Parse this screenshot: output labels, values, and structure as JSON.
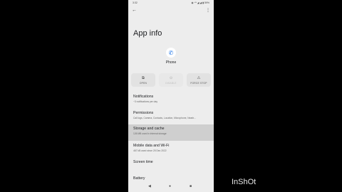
{
  "status_bar": {
    "time": "3:32",
    "icons": "◉ ⁴ᴳ ◢ ◢ ▮ 59%"
  },
  "header": {
    "back_glyph": "←",
    "more_glyph": "⋮",
    "title": "App info"
  },
  "app": {
    "icon_glyph": "✆",
    "name": "Phone"
  },
  "actions": {
    "open": {
      "icon": "⧉",
      "label": "OPEN"
    },
    "uninstall": {
      "icon": "⊖",
      "label": "DISABLE"
    },
    "force_stop": {
      "icon": "⚠",
      "label": "FORCE STOP"
    }
  },
  "settings": [
    {
      "title": "Notifications",
      "subtitle": "~3 notifications per day"
    },
    {
      "title": "Permissions",
      "subtitle": "Call logs, Camera, Contacts, Location, Microphone, Nearb..."
    },
    {
      "title": "Storage and cache",
      "subtitle": "126 MB used in internal storage"
    },
    {
      "title": "Mobile data and Wi-Fi",
      "subtitle": "467 kB used since 25 Dec 2022"
    },
    {
      "title": "Screen time",
      "subtitle": ""
    },
    {
      "title": "Battery",
      "subtitle": ""
    }
  ],
  "nav_bar": {
    "back": "◀",
    "home": "●",
    "recents": "■"
  },
  "watermark": "InShOt",
  "colors": {
    "screen_bg": "#ededed",
    "selected_row": "#cfcfcf",
    "accent": "#1a73e8"
  }
}
